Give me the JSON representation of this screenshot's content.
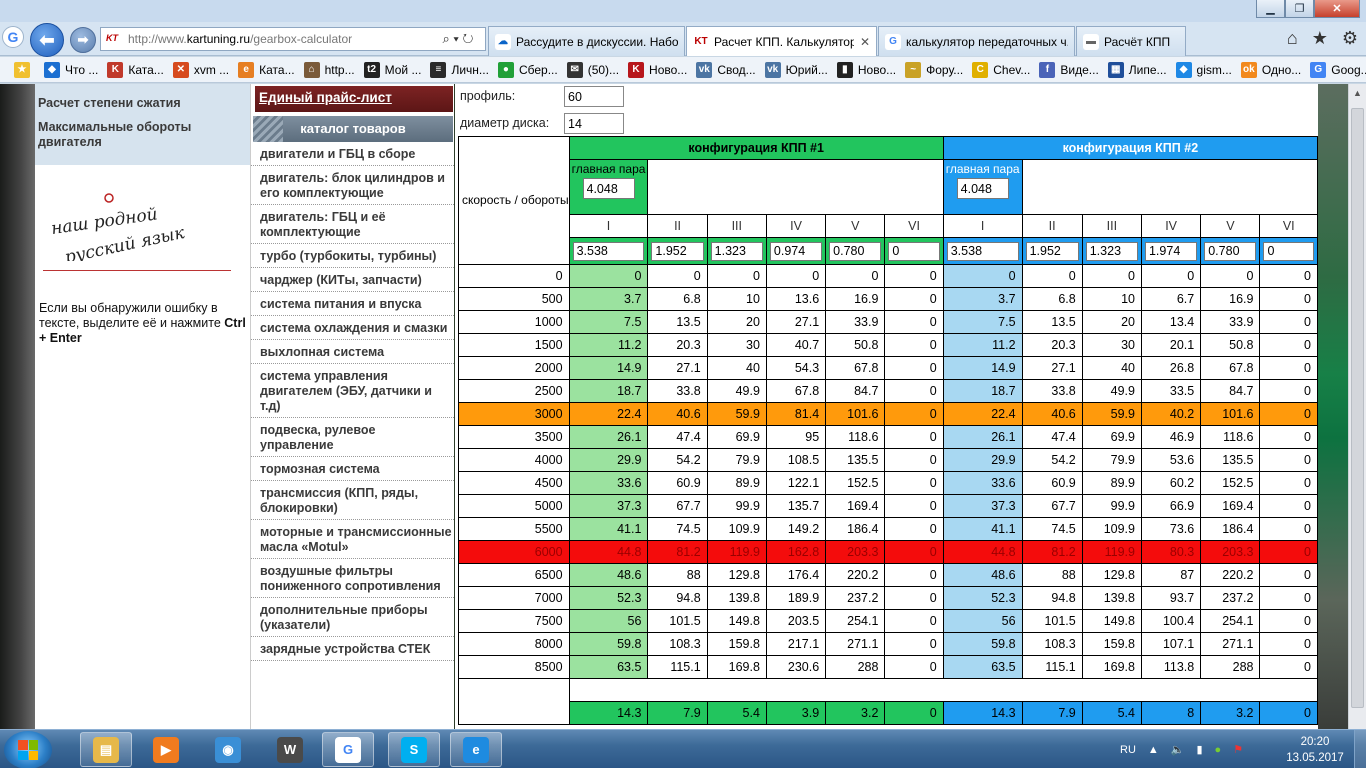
{
  "browser": {
    "url_prefix": "http://www.",
    "url_domain": "kartuning.ru",
    "url_path": "/gearbox-calculator",
    "addr_buttons": "⌕ ▾ ↻",
    "tabs": [
      {
        "label": "Рассудите в дискуссии. Набо...",
        "icon": "onedrive-icon",
        "active": false
      },
      {
        "label": "Расчет КПП. Калькулятор ...",
        "icon": "kt-icon",
        "active": true
      },
      {
        "label": "калькулятор передаточных ч...",
        "icon": "google-icon",
        "active": false
      },
      {
        "label": "Расчёт КПП",
        "icon": "car-icon",
        "active": false
      }
    ],
    "favorites": [
      {
        "label": "Что ...",
        "color": "#1b6fd1",
        "glyph": "◆"
      },
      {
        "label": "Ката...",
        "color": "#c0392b",
        "glyph": "K"
      },
      {
        "label": "xvm ...",
        "color": "#d64a1e",
        "glyph": "✕"
      },
      {
        "label": "Ката...",
        "color": "#e67e22",
        "glyph": "e"
      },
      {
        "label": "http...",
        "color": "#7a5a3a",
        "glyph": "⌂"
      },
      {
        "label": "Мой ...",
        "color": "#222222",
        "glyph": "t2"
      },
      {
        "label": "Личн...",
        "color": "#2a2a2a",
        "glyph": "≡"
      },
      {
        "label": "Сбер...",
        "color": "#21a038",
        "glyph": "●"
      },
      {
        "label": "(50)...",
        "color": "#333333",
        "glyph": "✉"
      },
      {
        "label": "Ново...",
        "color": "#b7161c",
        "glyph": "K"
      },
      {
        "label": "Свод...",
        "color": "#4c75a3",
        "glyph": "vk"
      },
      {
        "label": "Юрий...",
        "color": "#4c75a3",
        "glyph": "vk"
      },
      {
        "label": "Ново...",
        "color": "#222222",
        "glyph": "▮"
      },
      {
        "label": "Фору...",
        "color": "#c9a227",
        "glyph": "~"
      },
      {
        "label": "Chev...",
        "color": "#e0b000",
        "glyph": "C"
      },
      {
        "label": "Виде...",
        "color": "#4a63b8",
        "glyph": "f"
      },
      {
        "label": "Липе...",
        "color": "#1f4e9a",
        "glyph": "▦"
      },
      {
        "label": "gism...",
        "color": "#1e88e5",
        "glyph": "◆"
      },
      {
        "label": "Одно...",
        "color": "#f2891d",
        "glyph": "ok"
      },
      {
        "label": "Goog...",
        "color": "#4285f4",
        "glyph": "G"
      }
    ]
  },
  "sidebar": {
    "links": [
      "Расчет степени сжатия",
      "Максимальные обороты двигателя"
    ],
    "logo_text_line1": "наш родной",
    "logo_text_line2": "русский язык",
    "error_note": "Если вы обнаружили ошибку в тексте, выделите её и нажмите ",
    "error_keys": "Ctrl + Enter"
  },
  "catalog": {
    "price_link": "Единый прайс-лист",
    "title": "каталог товаров",
    "items": [
      "двигатели и ГБЦ в сборе",
      "двигатель: блок цилиндров и его комплектующие",
      "двигатель: ГБЦ и её комплектующие",
      "турбо (турбокиты, турбины)",
      "чарджер (КИТы, запчасти)",
      "система питания и впуска",
      "система охлаждения и смазки",
      "выхлопная система",
      "система управления двигателем (ЭБУ, датчики и т.д)",
      "подвеска, рулевое управление",
      "тормозная система",
      "трансмиссия (КПП, ряды, блокировки)",
      "моторные и трансмиссионные масла «Motul»",
      "воздушные фильтры пониженного сопротивления",
      "дополнительные приборы (указатели)",
      "зарядные устройства СТЕК"
    ]
  },
  "calculator": {
    "profile_label": "профиль:",
    "profile_value": "60",
    "disk_label": "диаметр диска:",
    "disk_value": "14",
    "speed_label": "скорость / обороты",
    "config1_title": "конфигурация КПП #1",
    "config2_title": "конфигурация КПП #2",
    "main_pair_label": "главная пара",
    "main_pair1": "4.048",
    "main_pair2": "4.048",
    "gears": [
      "I",
      "II",
      "III",
      "IV",
      "V",
      "VI"
    ],
    "ratios1": [
      "3.538",
      "1.952",
      "1.323",
      "0.974",
      "0.780",
      "0"
    ],
    "ratios2": [
      "3.538",
      "1.952",
      "1.323",
      "1.974",
      "0.780",
      "0"
    ],
    "highlight_orange_rpm": 3000,
    "highlight_red_rpm": 6000,
    "rows": [
      {
        "rpm": "0",
        "c1": [
          "0",
          "0",
          "0",
          "0",
          "0",
          "0"
        ],
        "c2": [
          "0",
          "0",
          "0",
          "0",
          "0",
          "0"
        ]
      },
      {
        "rpm": "500",
        "c1": [
          "3.7",
          "6.8",
          "10",
          "13.6",
          "16.9",
          "0"
        ],
        "c2": [
          "3.7",
          "6.8",
          "10",
          "6.7",
          "16.9",
          "0"
        ]
      },
      {
        "rpm": "1000",
        "c1": [
          "7.5",
          "13.5",
          "20",
          "27.1",
          "33.9",
          "0"
        ],
        "c2": [
          "7.5",
          "13.5",
          "20",
          "13.4",
          "33.9",
          "0"
        ]
      },
      {
        "rpm": "1500",
        "c1": [
          "11.2",
          "20.3",
          "30",
          "40.7",
          "50.8",
          "0"
        ],
        "c2": [
          "11.2",
          "20.3",
          "30",
          "20.1",
          "50.8",
          "0"
        ]
      },
      {
        "rpm": "2000",
        "c1": [
          "14.9",
          "27.1",
          "40",
          "54.3",
          "67.8",
          "0"
        ],
        "c2": [
          "14.9",
          "27.1",
          "40",
          "26.8",
          "67.8",
          "0"
        ]
      },
      {
        "rpm": "2500",
        "c1": [
          "18.7",
          "33.8",
          "49.9",
          "67.8",
          "84.7",
          "0"
        ],
        "c2": [
          "18.7",
          "33.8",
          "49.9",
          "33.5",
          "84.7",
          "0"
        ]
      },
      {
        "rpm": "3000",
        "c1": [
          "22.4",
          "40.6",
          "59.9",
          "81.4",
          "101.6",
          "0"
        ],
        "c2": [
          "22.4",
          "40.6",
          "59.9",
          "40.2",
          "101.6",
          "0"
        ]
      },
      {
        "rpm": "3500",
        "c1": [
          "26.1",
          "47.4",
          "69.9",
          "95",
          "118.6",
          "0"
        ],
        "c2": [
          "26.1",
          "47.4",
          "69.9",
          "46.9",
          "118.6",
          "0"
        ]
      },
      {
        "rpm": "4000",
        "c1": [
          "29.9",
          "54.2",
          "79.9",
          "108.5",
          "135.5",
          "0"
        ],
        "c2": [
          "29.9",
          "54.2",
          "79.9",
          "53.6",
          "135.5",
          "0"
        ]
      },
      {
        "rpm": "4500",
        "c1": [
          "33.6",
          "60.9",
          "89.9",
          "122.1",
          "152.5",
          "0"
        ],
        "c2": [
          "33.6",
          "60.9",
          "89.9",
          "60.2",
          "152.5",
          "0"
        ]
      },
      {
        "rpm": "5000",
        "c1": [
          "37.3",
          "67.7",
          "99.9",
          "135.7",
          "169.4",
          "0"
        ],
        "c2": [
          "37.3",
          "67.7",
          "99.9",
          "66.9",
          "169.4",
          "0"
        ]
      },
      {
        "rpm": "5500",
        "c1": [
          "41.1",
          "74.5",
          "109.9",
          "149.2",
          "186.4",
          "0"
        ],
        "c2": [
          "41.1",
          "74.5",
          "109.9",
          "73.6",
          "186.4",
          "0"
        ]
      },
      {
        "rpm": "6000",
        "c1": [
          "44.8",
          "81.2",
          "119.9",
          "162.8",
          "203.3",
          "0"
        ],
        "c2": [
          "44.8",
          "81.2",
          "119.9",
          "80.3",
          "203.3",
          "0"
        ]
      },
      {
        "rpm": "6500",
        "c1": [
          "48.6",
          "88",
          "129.8",
          "176.4",
          "220.2",
          "0"
        ],
        "c2": [
          "48.6",
          "88",
          "129.8",
          "87",
          "220.2",
          "0"
        ]
      },
      {
        "rpm": "7000",
        "c1": [
          "52.3",
          "94.8",
          "139.8",
          "189.9",
          "237.2",
          "0"
        ],
        "c2": [
          "52.3",
          "94.8",
          "139.8",
          "93.7",
          "237.2",
          "0"
        ]
      },
      {
        "rpm": "7500",
        "c1": [
          "56",
          "101.5",
          "149.8",
          "203.5",
          "254.1",
          "0"
        ],
        "c2": [
          "56",
          "101.5",
          "149.8",
          "100.4",
          "254.1",
          "0"
        ]
      },
      {
        "rpm": "8000",
        "c1": [
          "59.8",
          "108.3",
          "159.8",
          "217.1",
          "271.1",
          "0"
        ],
        "c2": [
          "59.8",
          "108.3",
          "159.8",
          "107.1",
          "271.1",
          "0"
        ]
      },
      {
        "rpm": "8500",
        "c1": [
          "63.5",
          "115.1",
          "169.8",
          "230.6",
          "288",
          "0"
        ],
        "c2": [
          "63.5",
          "115.1",
          "169.8",
          "113.8",
          "288",
          "0"
        ]
      }
    ],
    "footer1": [
      "14.3",
      "7.9",
      "5.4",
      "3.9",
      "3.2",
      "0"
    ],
    "footer2": [
      "14.3",
      "7.9",
      "5.4",
      "8",
      "3.2",
      "0"
    ]
  },
  "taskbar": {
    "apps": [
      {
        "name": "explorer-icon",
        "color": "#e6b84a",
        "glyph": "▤",
        "running": true
      },
      {
        "name": "media-player-icon",
        "color": "#f07b1f",
        "glyph": "▶",
        "running": false
      },
      {
        "name": "chrome-icon",
        "color": "#3a8fd6",
        "glyph": "◉",
        "running": false
      },
      {
        "name": "world-of-tanks-icon",
        "color": "#4a4a4a",
        "glyph": "W",
        "running": false
      },
      {
        "name": "google-chrome-running-icon",
        "color": "#ffffff",
        "glyph": "G",
        "running": true
      },
      {
        "name": "skype-icon",
        "color": "#00aff0",
        "glyph": "S",
        "running": true
      },
      {
        "name": "internet-explorer-icon",
        "color": "#1e8be0",
        "glyph": "e",
        "running": true
      }
    ],
    "lang": "RU",
    "time": "20:20",
    "date": "13.05.2017"
  },
  "colors": {
    "config1": "#22c55e",
    "config2": "#1f9cf0",
    "highlight_orange": "#ff9a0c",
    "highlight_red": "#f40c0c"
  }
}
